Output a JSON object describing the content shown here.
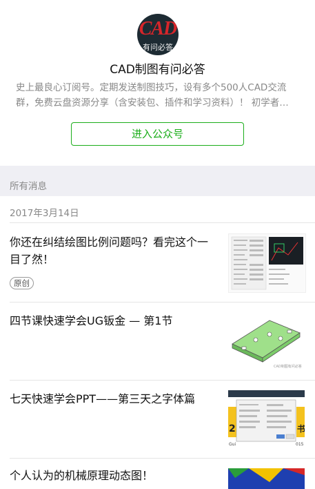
{
  "profile": {
    "avatar_text": "CAD",
    "avatar_sub": "有问必答",
    "name": "CAD制图有问必答",
    "description": "史上最良心订阅号。定期发送制图技巧，设有多个500人CAD交流群，免费云盘资源分享（含安装包、插件和学习资料）！ 初学者…",
    "follow_label": "进入公众号"
  },
  "section": {
    "label": "所有消息"
  },
  "group": {
    "date": "2017年3月14日"
  },
  "articles": [
    {
      "title": "你还在纠结绘图比例问题吗？看完这个一目了然！",
      "badge": "原创"
    },
    {
      "title": "四节课快速学会UG钣金 — 第1节"
    },
    {
      "title": "七天快速学会PPT——第三天之字体篇"
    },
    {
      "title": "个人认为的机械原理动态图！"
    }
  ],
  "colors": {
    "accent": "#1aad19",
    "section_bg": "#efeff4"
  }
}
